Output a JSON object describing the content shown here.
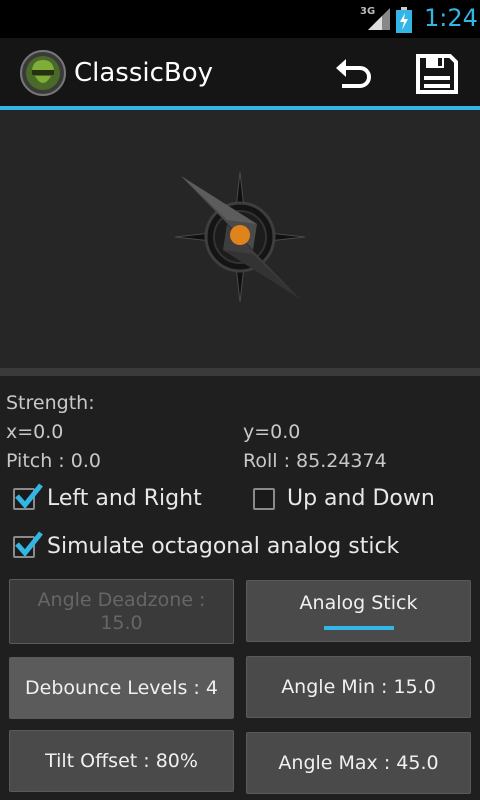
{
  "status_bar": {
    "network": "3G",
    "time": "1:24"
  },
  "action_bar": {
    "title": "ClassicBoy",
    "undo_icon": "undo-icon",
    "save_icon": "save-icon",
    "accent": "#33b5e5"
  },
  "readouts": {
    "strength_label": "Strength:",
    "x": "x=0.0",
    "y": "y=0.0",
    "pitch": "Pitch : 0.0",
    "roll": "Roll : 85.24374"
  },
  "checkboxes": {
    "left_right": {
      "label": "Left and Right",
      "checked": true
    },
    "up_down": {
      "label": "Up and Down",
      "checked": false
    },
    "octagonal": {
      "label": "Simulate octagonal analog stick",
      "checked": true
    }
  },
  "buttons": {
    "angle_deadzone": "Angle Deadzone :\n15.0",
    "analog_stick": "Analog Stick",
    "debounce_levels": "Debounce Levels : 4",
    "angle_min": "Angle Min : 15.0",
    "tilt_offset": "Tilt Offset : 80%",
    "angle_max": "Angle Max : 45.0"
  }
}
